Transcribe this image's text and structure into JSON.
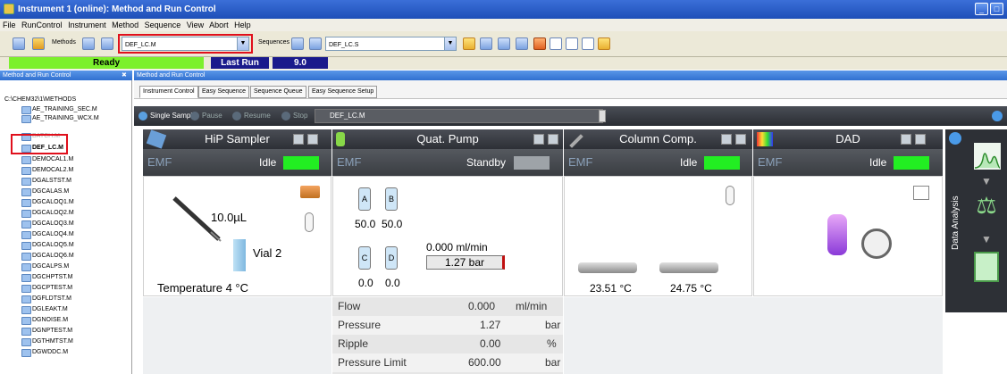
{
  "window": {
    "title": "Instrument 1 (online): Method and Run Control"
  },
  "menu": [
    "File",
    "RunControl",
    "Instrument",
    "Method",
    "Sequence",
    "View",
    "Abort",
    "Help"
  ],
  "toolbar": {
    "methods_label": "Methods",
    "method_value": "DEF_LC.M",
    "sequences_label": "Sequences",
    "sequence_value": "DEF_LC.S"
  },
  "status": {
    "ready": "Ready",
    "last_run_label": "Last Run",
    "last_run_value": "9.0"
  },
  "left_panel": {
    "title": "Method and Run Control",
    "root": "C:\\CHEM32\\1\\METHODS",
    "items": [
      "AE_TRAINING_SEC.M",
      "AE_TRAINING_WCX.M",
      "BATCH.M",
      "DEF_LC.M",
      "DEMOCAL1.M",
      "DEMOCAL2.M",
      "DGALSTST.M",
      "DGCALAS.M",
      "DGCALOQ1.M",
      "DGCALOQ2.M",
      "DGCALOQ3.M",
      "DGCALOQ4.M",
      "DGCALOQ5.M",
      "DGCALOQ6.M",
      "DGCALPS.M",
      "DGCHPTST.M",
      "DGCPTEST.M",
      "DGFLDTST.M",
      "DGLEAKT.M",
      "DGNOISE.M",
      "DGNPTEST.M",
      "DGTHMTST.M",
      "DGWDDC.M"
    ]
  },
  "right_panel": {
    "title": "Method and Run Control",
    "tabs": [
      "Instrument Control",
      "Easy Sequence",
      "Sequence Queue",
      "Easy Sequence Setup"
    ]
  },
  "control_bar": {
    "single_sample": "Single Sample",
    "pause": "Pause",
    "resume": "Resume",
    "stop": "Stop",
    "method": "DEF_LC.M"
  },
  "modules": {
    "sampler": {
      "title": "HiP Sampler",
      "emf": "EMF",
      "state": "Idle",
      "volume": "10.0µL",
      "vial": "Vial 2",
      "temperature": "Temperature 4 °C"
    },
    "pump": {
      "title": "Quat. Pump",
      "emf": "EMF",
      "state": "Standby",
      "bottles": [
        "A",
        "B",
        "C",
        "D"
      ],
      "levels": [
        "50.0",
        "50.0",
        "0.0",
        "0.0"
      ],
      "flow": "0.000 ml/min",
      "pressure": "1.27 bar"
    },
    "column": {
      "title": "Column Comp.",
      "emf": "EMF",
      "state": "Idle",
      "temp_left": "23.51 °C",
      "temp_right": "24.75 °C"
    },
    "dad": {
      "title": "DAD",
      "emf": "EMF",
      "state": "Idle"
    }
  },
  "pump_table": [
    {
      "label": "Flow",
      "value": "0.000",
      "unit": "ml/min"
    },
    {
      "label": "Pressure",
      "value": "1.27",
      "unit": "bar"
    },
    {
      "label": "Ripple",
      "value": "0.00",
      "unit": "%"
    },
    {
      "label": "Pressure Limit",
      "value": "600.00",
      "unit": "bar"
    }
  ],
  "sidebar": {
    "data_analysis": "Data Analysis"
  },
  "colors": {
    "ready_green": "#7cf02c",
    "status_green": "#22ee22",
    "last_run_navy": "#1a1a8c",
    "highlight_red": "#e0101c"
  }
}
